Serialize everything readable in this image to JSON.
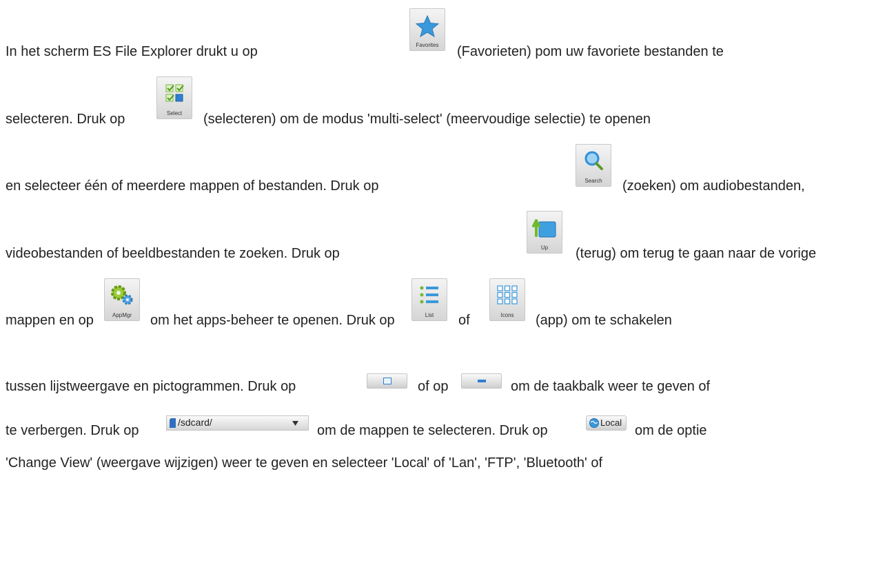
{
  "icons": {
    "favorites": {
      "caption": "Favorites",
      "icon": "star-icon"
    },
    "select": {
      "caption": "Select",
      "icon": "checkbox-grid-icon"
    },
    "search": {
      "caption": "Search",
      "icon": "magnifier-icon"
    },
    "up": {
      "caption": "Up",
      "icon": "folder-up-icon"
    },
    "appmgr": {
      "caption": "AppMgr",
      "icon": "gears-icon"
    },
    "list": {
      "caption": "List",
      "icon": "list-icon"
    },
    "icons": {
      "caption": "Icons",
      "icon": "grid-icon"
    },
    "maximize": {
      "icon": "window-maximize-icon"
    },
    "minimize": {
      "icon": "window-minimize-icon"
    },
    "path": {
      "value": "/sdcard/",
      "icon": "sdcard-icon"
    },
    "local": {
      "label": "Local",
      "icon": "globe-icon"
    }
  },
  "text": {
    "l1a": "In het scherm  ES File Explorer drukt u op",
    "l1b": "(Favorieten) pom uw favoriete bestanden te",
    "l2a": "selecteren. Druk op",
    "l2b": "(selecteren) om de modus 'multi-select' (meervoudige selectie) te openen",
    "l3a": "en selecteer één of meerdere mappen of bestanden. Druk op",
    "l3b": "(zoeken) om audiobestanden,",
    "l4a": "videobestanden of beeldbestanden te zoeken. Druk op",
    "l4b": "(terug) om terug te gaan naar de vorige",
    "l5a": "mappen en op",
    "l5b": "om het apps-beheer te openen. Druk op",
    "l5c": "of",
    "l5d": "(app) om te schakelen",
    "l6a": "tussen lijstweergave en pictogrammen. Druk op",
    "l6b": "of op",
    "l6c": "om de taakbalk weer te geven of",
    "l7a": "te verbergen. Druk op",
    "l7b": "om de mappen te selecteren. Druk op",
    "l7c": "om de optie",
    "l8": "'Change View' (weergave wijzigen) weer te geven en selecteer 'Local' of 'Lan', 'FTP', 'Bluetooth' of"
  },
  "colors": {
    "accent": "#2f8fd8",
    "icon_green": "#6fb92e"
  }
}
